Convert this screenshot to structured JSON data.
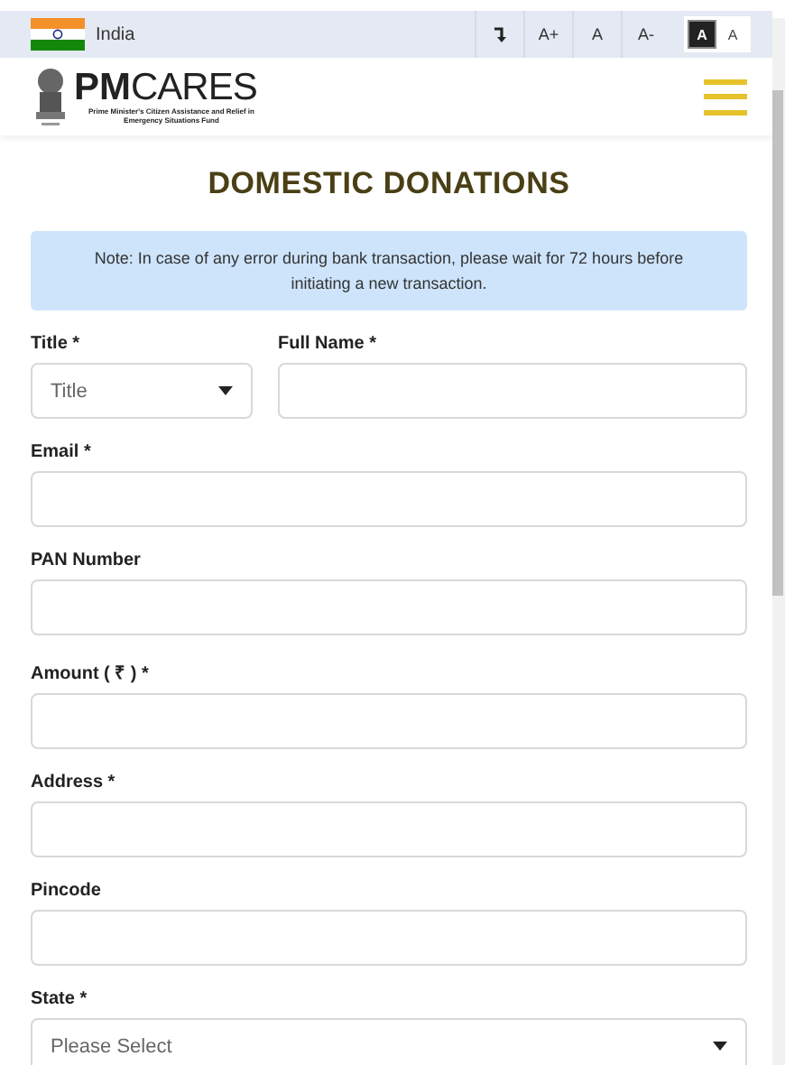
{
  "top_bar": {
    "country": "India",
    "font_buttons": [
      "A+",
      "A",
      "A-"
    ],
    "contrast_buttons": [
      {
        "label": "A",
        "kind": "dark",
        "selected": true
      },
      {
        "label": "A",
        "kind": "light",
        "selected": false
      }
    ]
  },
  "header": {
    "logo_bold": "PM",
    "logo_light": "CARES",
    "logo_subtitle": "Prime Minister's Citizen Assistance and Relief in Emergency Situations Fund"
  },
  "page_title": "DOMESTIC DONATIONS",
  "note": "Note: In case of any error during bank transaction, please wait for 72 hours before initiating a new transaction.",
  "form_rows": [
    {
      "fields": [
        {
          "label": "Title *",
          "kind": "select",
          "placeholder": "Title"
        },
        {
          "label": "Full Name *",
          "kind": "text"
        }
      ]
    },
    {
      "fields": [
        {
          "label": "Email *",
          "kind": "text"
        }
      ]
    },
    {
      "fields": [
        {
          "label": "PAN Number",
          "kind": "text"
        }
      ]
    },
    {
      "fields": [
        {
          "label": "Amount ( ₹ ) *",
          "kind": "text"
        }
      ]
    },
    {
      "fields": [
        {
          "label": "Address *",
          "kind": "text"
        }
      ]
    },
    {
      "fields": [
        {
          "label": "Pincode",
          "kind": "text"
        }
      ]
    },
    {
      "fields": [
        {
          "label": "State *",
          "kind": "select",
          "placeholder": "Please Select"
        }
      ]
    }
  ]
}
